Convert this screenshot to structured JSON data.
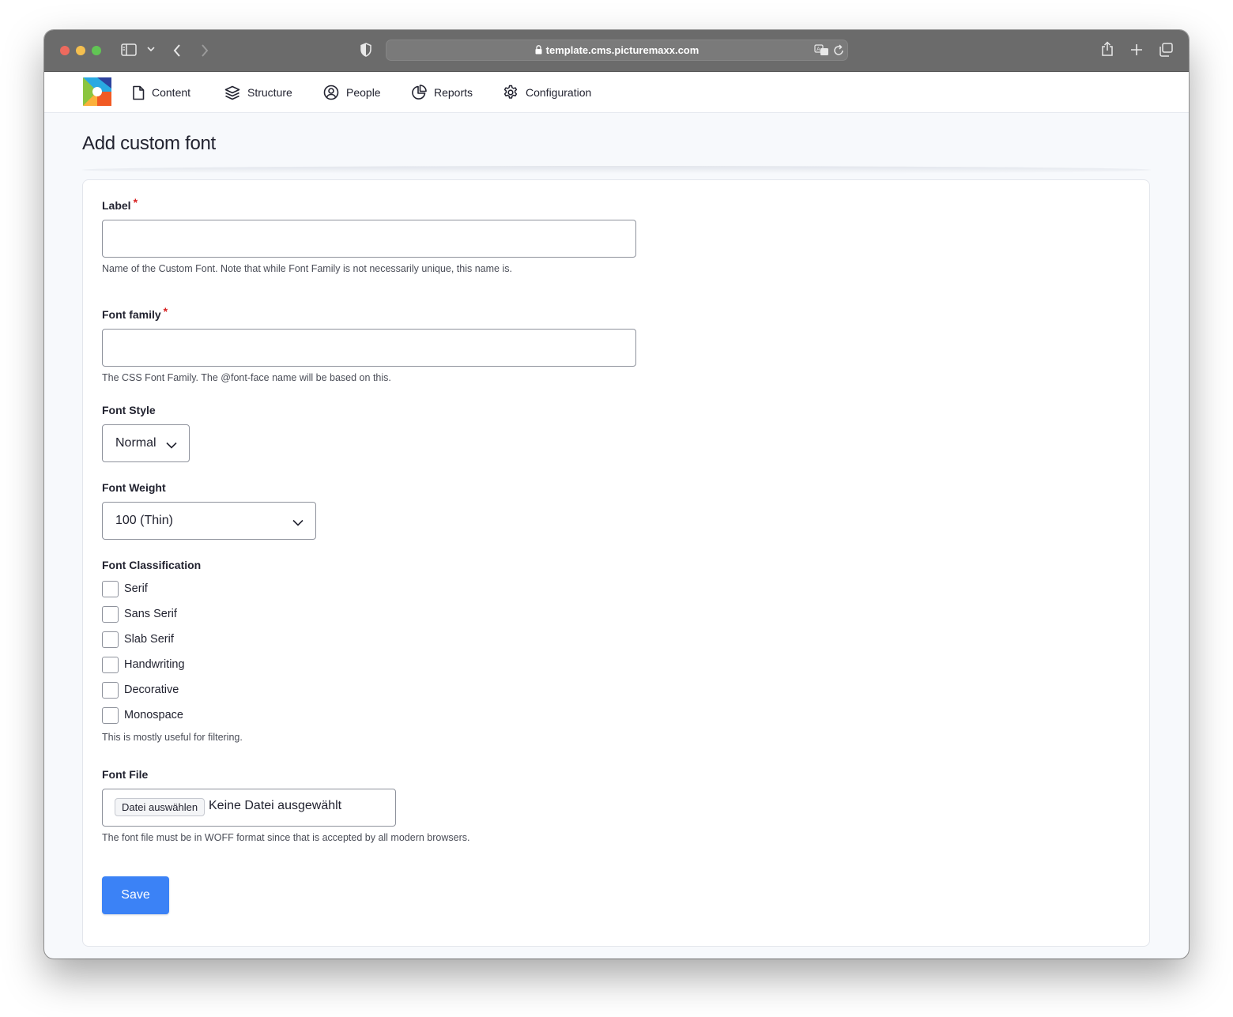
{
  "browser": {
    "url": "template.cms.picturemaxx.com"
  },
  "nav": {
    "items": [
      {
        "label": "Content",
        "icon": "file-icon"
      },
      {
        "label": "Structure",
        "icon": "layers-icon"
      },
      {
        "label": "People",
        "icon": "user-circle-icon"
      },
      {
        "label": "Reports",
        "icon": "pie-chart-icon"
      },
      {
        "label": "Configuration",
        "icon": "gear-icon"
      }
    ]
  },
  "page": {
    "title": "Add custom font"
  },
  "form": {
    "label": {
      "label": "Label",
      "required_mark": "*",
      "value": "",
      "description": "Name of the Custom Font. Note that while Font Family is not necessarily unique, this name is."
    },
    "font_family": {
      "label": "Font family",
      "required_mark": "*",
      "value": "",
      "description": "The CSS Font Family. The @font-face name will be based on this."
    },
    "font_style": {
      "label": "Font Style",
      "selected": "Normal"
    },
    "font_weight": {
      "label": "Font Weight",
      "selected": "100 (Thin)"
    },
    "font_classification": {
      "label": "Font Classification",
      "options": [
        {
          "label": "Serif",
          "checked": false
        },
        {
          "label": "Sans Serif",
          "checked": false
        },
        {
          "label": "Slab Serif",
          "checked": false
        },
        {
          "label": "Handwriting",
          "checked": false
        },
        {
          "label": "Decorative",
          "checked": false
        },
        {
          "label": "Monospace",
          "checked": false
        }
      ],
      "description": "This is mostly useful for filtering."
    },
    "font_file": {
      "label": "Font File",
      "button_label": "Datei auswählen",
      "status": "Keine Datei ausgewählt",
      "description": "The font file must be in WOFF format since that is accepted by all modern browsers."
    },
    "save_label": "Save"
  },
  "colors": {
    "accent": "#3b82f6",
    "required": "#d72222"
  }
}
